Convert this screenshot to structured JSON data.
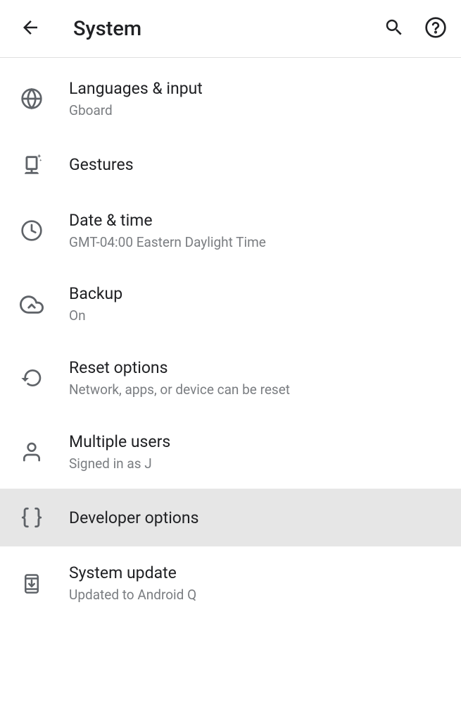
{
  "header": {
    "title": "System"
  },
  "items": [
    {
      "title": "Languages & input",
      "subtitle": "Gboard"
    },
    {
      "title": "Gestures",
      "subtitle": ""
    },
    {
      "title": "Date & time",
      "subtitle": "GMT-04:00 Eastern Daylight Time"
    },
    {
      "title": "Backup",
      "subtitle": "On"
    },
    {
      "title": "Reset options",
      "subtitle": "Network, apps, or device can be reset"
    },
    {
      "title": "Multiple users",
      "subtitle": "Signed in as J"
    },
    {
      "title": "Developer options",
      "subtitle": ""
    },
    {
      "title": "System update",
      "subtitle": "Updated to Android Q"
    }
  ]
}
